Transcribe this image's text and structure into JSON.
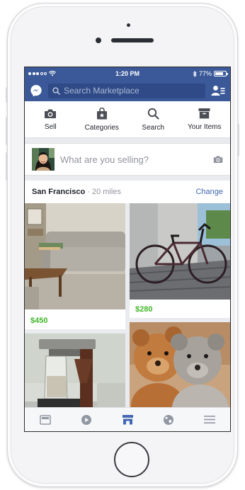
{
  "status_bar": {
    "time": "1:20 PM",
    "battery": "77%",
    "battery_level": 0.77
  },
  "nav": {
    "search_placeholder": "Search Marketplace",
    "left_icon": "messenger-icon",
    "right_icon": "friend-requests-icon"
  },
  "actions": [
    {
      "label": "Sell",
      "icon": "camera-icon"
    },
    {
      "label": "Categories",
      "icon": "shopping-bag-icon"
    },
    {
      "label": "Search",
      "icon": "search-icon"
    },
    {
      "label": "Your Items",
      "icon": "box-icon"
    }
  ],
  "composer": {
    "placeholder": "What are you selling?",
    "icon": "camera-icon"
  },
  "location": {
    "city": "San Francisco",
    "distance": " · 20 miles",
    "change_label": "Change"
  },
  "listings": [
    {
      "price": "$450",
      "image": "sofa-photo"
    },
    {
      "price": "$280",
      "image": "bicycle-photo"
    },
    {
      "price": "",
      "image": "coffee-maker-photo"
    },
    {
      "price": "",
      "image": "teddy-bears-photo"
    }
  ],
  "tabs": [
    {
      "icon": "news-feed-icon",
      "active": false
    },
    {
      "icon": "video-icon",
      "active": false
    },
    {
      "icon": "marketplace-icon",
      "active": true
    },
    {
      "icon": "globe-icon",
      "active": false
    },
    {
      "icon": "menu-icon",
      "active": false
    }
  ],
  "colors": {
    "brand": "#3b5998",
    "price": "#42b72a",
    "link": "#4267b2",
    "tab_active": "#4267b2",
    "tab_inactive": "#9197a3"
  }
}
